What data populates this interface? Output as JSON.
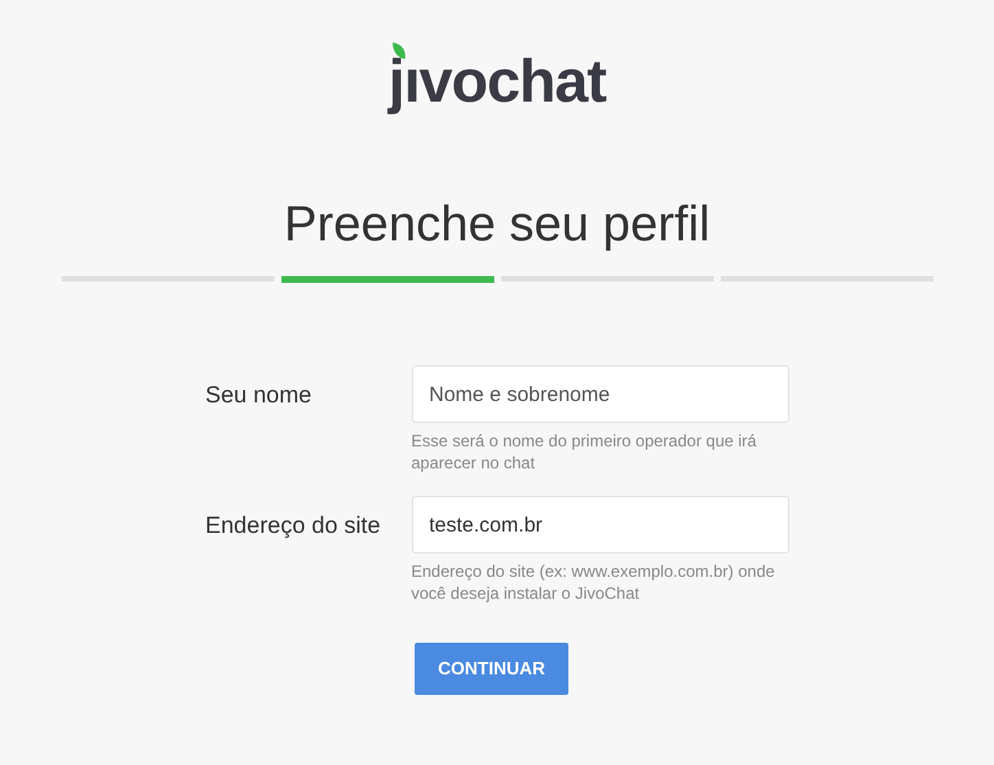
{
  "logo": {
    "text": "jıvochat"
  },
  "title": "Preenche seu perfil",
  "steps": [
    {
      "selected": false
    },
    {
      "selected": true
    },
    {
      "selected": false
    },
    {
      "selected": false
    }
  ],
  "fields": [
    {
      "label": "Seu nome",
      "placeholder": "Nome e sobrenome",
      "hint": "Esse será o nome do primeiro operador que irá aparecer no chat"
    },
    {
      "label": "Endereço do site",
      "value": "teste.com.br",
      "hint": "Endereço do site (ex: www.exemplo.com.br) onde você deseja instalar o JivoChat"
    }
  ],
  "button": "CONTINUAR"
}
